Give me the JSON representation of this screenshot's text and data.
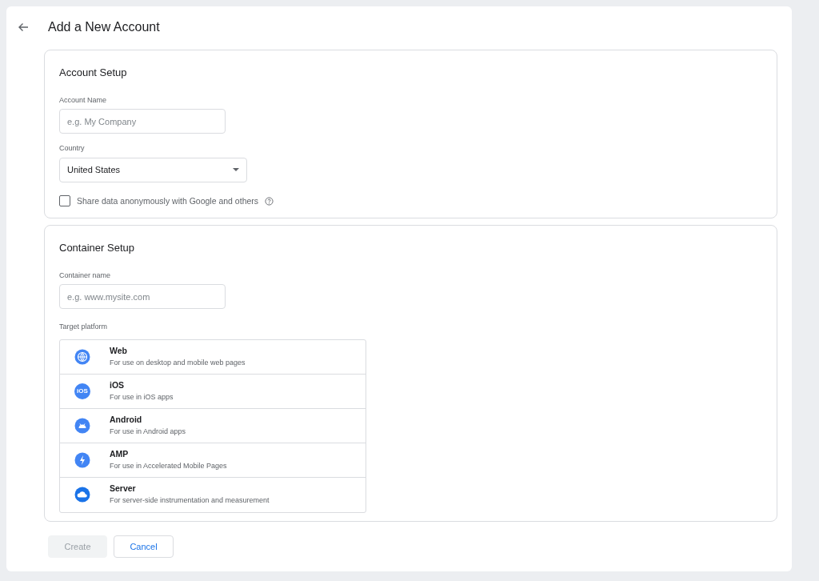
{
  "page": {
    "title": "Add a New Account"
  },
  "account_setup": {
    "title": "Account Setup",
    "account_name": {
      "label": "Account Name",
      "placeholder": "e.g. My Company"
    },
    "country": {
      "label": "Country",
      "value": "United States"
    },
    "share_data": {
      "label": "Share data anonymously with Google and others",
      "checked": false
    }
  },
  "container_setup": {
    "title": "Container Setup",
    "container_name": {
      "label": "Container name",
      "placeholder": "e.g. www.mysite.com"
    },
    "target_platform_label": "Target platform",
    "platforms": [
      {
        "kind": "web",
        "name": "Web",
        "description": "For use on desktop and mobile web pages"
      },
      {
        "kind": "ios",
        "name": "iOS",
        "description": "For use in iOS apps",
        "icon_text": "iOS"
      },
      {
        "kind": "android",
        "name": "Android",
        "description": "For use in Android apps"
      },
      {
        "kind": "amp",
        "name": "AMP",
        "description": "For use in Accelerated Mobile Pages"
      },
      {
        "kind": "server",
        "name": "Server",
        "description": "For server-side instrumentation and measurement"
      }
    ]
  },
  "buttons": [
    {
      "label": "Create",
      "disabled": true
    },
    {
      "label": "Cancel",
      "disabled": false
    }
  ]
}
